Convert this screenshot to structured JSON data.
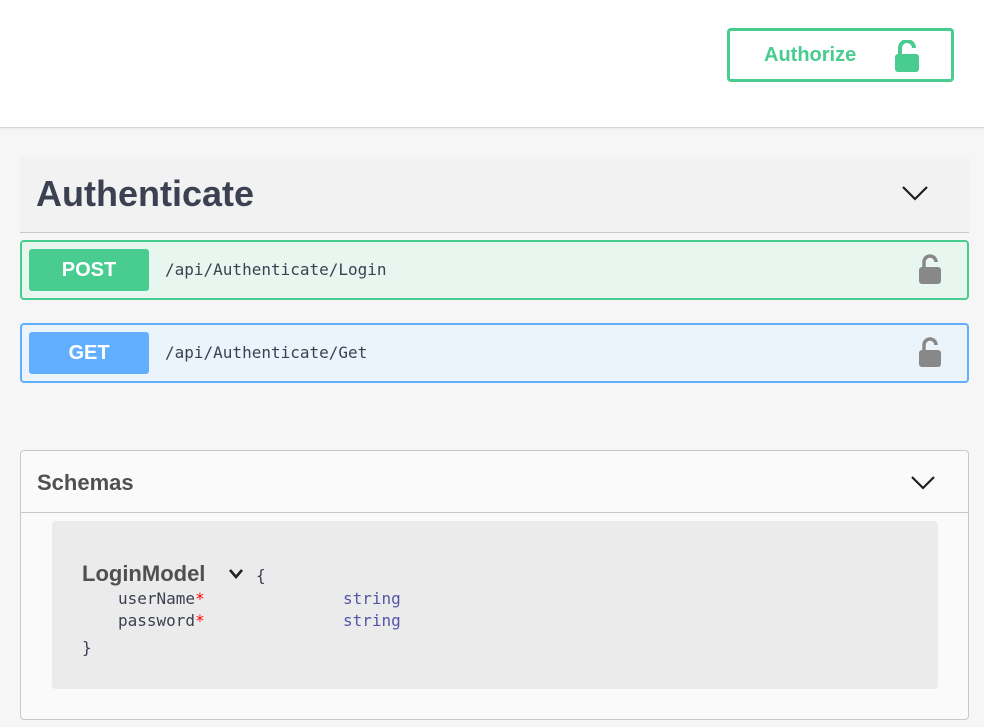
{
  "topbar": {
    "authorize_label": "Authorize"
  },
  "tag": {
    "name": "Authenticate"
  },
  "operations": [
    {
      "method": "POST",
      "path": "/api/Authenticate/Login"
    },
    {
      "method": "GET",
      "path": "/api/Authenticate/Get"
    }
  ],
  "schemas": {
    "title": "Schemas",
    "model": {
      "name": "LoginModel",
      "open_brace": "{",
      "close_brace": "}",
      "properties": [
        {
          "name": "userName",
          "required": "*",
          "type": "string"
        },
        {
          "name": "password",
          "required": "*",
          "type": "string"
        }
      ]
    }
  },
  "colors": {
    "post": "#49cc90",
    "get": "#61affe",
    "post_bg": "#e8f6f0",
    "get_bg": "#ebf3fb",
    "text": "#3b4151"
  },
  "icons": {
    "authorize": "unlocked-icon",
    "operation": "unlocked-icon",
    "collapse": "chevron-down-icon"
  }
}
